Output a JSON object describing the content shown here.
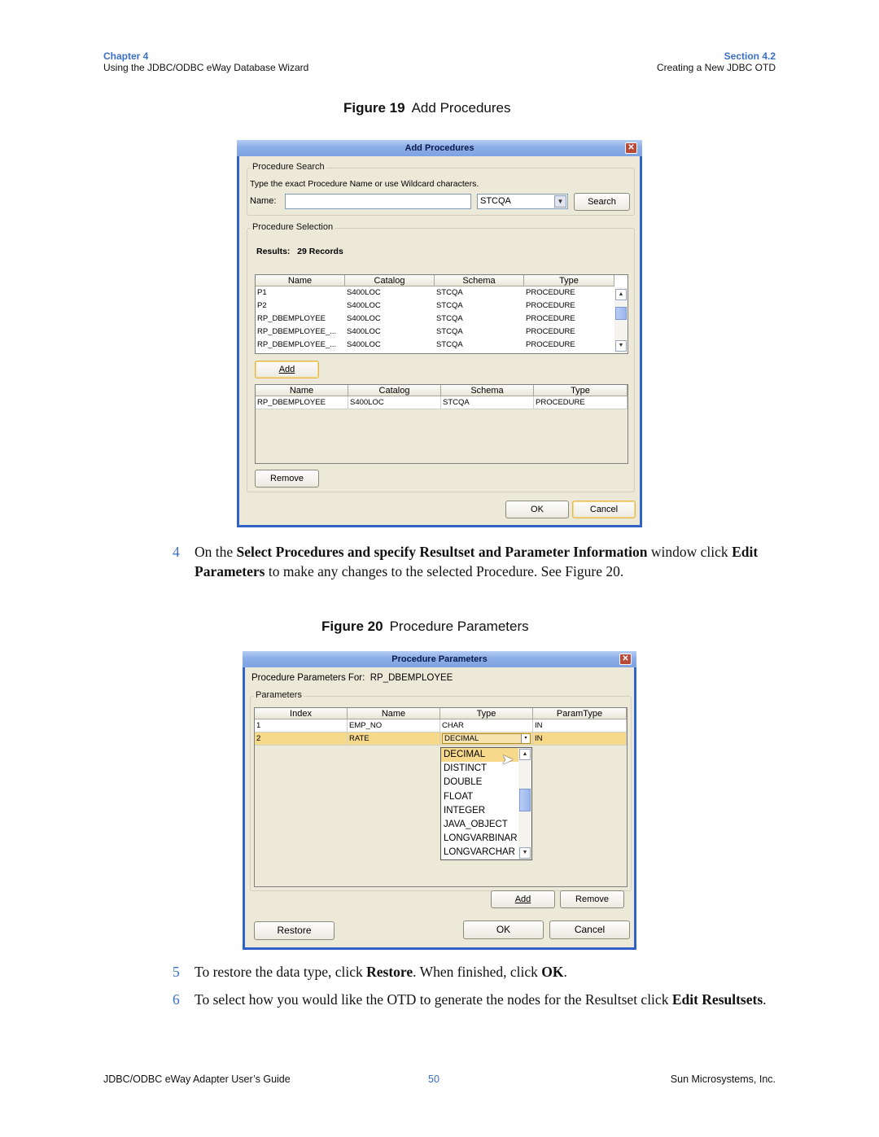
{
  "header": {
    "chapter_label": "Chapter 4",
    "chapter_title": "Using the JDBC/ODBC eWay Database Wizard",
    "section_label": "Section 4.2",
    "section_title": "Creating a New JDBC OTD"
  },
  "figure19": {
    "label": "Figure 19",
    "title": "Add Procedures",
    "dialog": {
      "title": "Add Procedures",
      "search_group": "Procedure Search",
      "hint": "Type the exact Procedure Name or use Wildcard characters.",
      "name_label": "Name:",
      "name_value": "",
      "schema_value": "STCQA",
      "search_button": "Search",
      "selection_group": "Procedure Selection",
      "results_text": "Results:   29 Records",
      "columns": [
        "Name",
        "Catalog",
        "Schema",
        "Type"
      ],
      "results_rows": [
        [
          "P1",
          "S400LOC",
          "STCQA",
          "PROCEDURE"
        ],
        [
          "P2",
          "S400LOC",
          "STCQA",
          "PROCEDURE"
        ],
        [
          "RP_DBEMPLOYEE",
          "S400LOC",
          "STCQA",
          "PROCEDURE"
        ],
        [
          "RP_DBEMPLOYEE_...",
          "S400LOC",
          "STCQA",
          "PROCEDURE"
        ],
        [
          "RP_DBEMPLOYEE_...",
          "S400LOC",
          "STCQA",
          "PROCEDURE"
        ]
      ],
      "add_button": "Add",
      "selected_rows": [
        [
          "RP_DBEMPLOYEE",
          "S400LOC",
          "STCQA",
          "PROCEDURE"
        ]
      ],
      "remove_button": "Remove",
      "ok_button": "OK",
      "cancel_button": "Cancel"
    }
  },
  "step4": {
    "number": "4",
    "t1": "On the ",
    "b1": "Select Procedures and specify Resultset and Parameter Information",
    "t2": " window click ",
    "b2": "Edit Parameters",
    "t3": " to make any changes to the selected Procedure. See Figure 20."
  },
  "figure20": {
    "label": "Figure 20",
    "title": "Procedure Parameters",
    "dialog": {
      "title": "Procedure Parameters",
      "for_label": "Procedure Parameters For:",
      "for_value": "RP_DBEMPLOYEE",
      "group": "Parameters",
      "columns": [
        "Index",
        "Name",
        "Type",
        "ParamType"
      ],
      "rows": [
        [
          "1",
          "EMP_NO",
          "CHAR",
          "IN"
        ],
        [
          "2",
          "RATE",
          "DECIMAL",
          "IN"
        ]
      ],
      "dropdown_options": [
        "DECIMAL",
        "DISTINCT",
        "DOUBLE",
        "FLOAT",
        "INTEGER",
        "JAVA_OBJECT",
        "LONGVARBINAR",
        "LONGVARCHAR"
      ],
      "add_button": "Add",
      "remove_button": "Remove",
      "restore_button": "Restore",
      "ok_button": "OK",
      "cancel_button": "Cancel"
    }
  },
  "step5": {
    "number": "5",
    "t1": "To restore the data type, click ",
    "b1": "Restore",
    "t2": ". When finished, click ",
    "b2": "OK",
    "t3": "."
  },
  "step6": {
    "number": "6",
    "t1": "To select how you would like the OTD to generate the nodes for the Resultset click ",
    "b1": "Edit Resultsets",
    "t2": "."
  },
  "footer": {
    "guide": "JDBC/ODBC eWay Adapter User’s Guide",
    "page": "50",
    "company": "Sun Microsystems, Inc."
  }
}
